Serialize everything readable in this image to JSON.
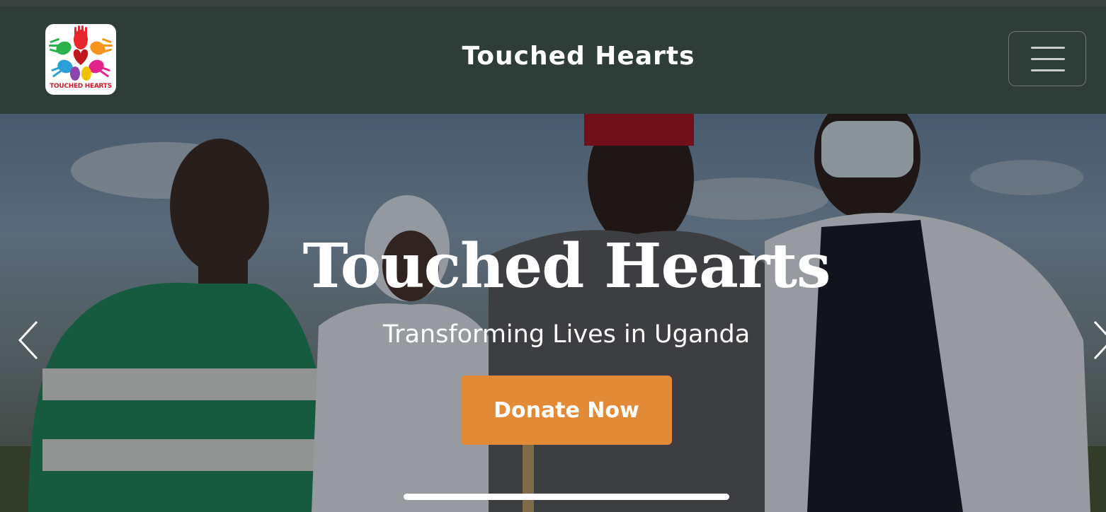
{
  "navbar": {
    "logo_text": "TOUCHED HEARTS",
    "title": "Touched Hearts",
    "menu_icon": "hamburger-icon"
  },
  "hero": {
    "title": "Touched Hearts",
    "subtitle": "Transforming Lives in Uganda",
    "donate_label": "Donate Now",
    "prev_icon": "chevron-left-icon",
    "next_icon": "chevron-right-icon"
  },
  "colors": {
    "navbar_bg": "#2f3d38",
    "donate_button": "#e28a36",
    "logo_text": "#d8182a"
  }
}
